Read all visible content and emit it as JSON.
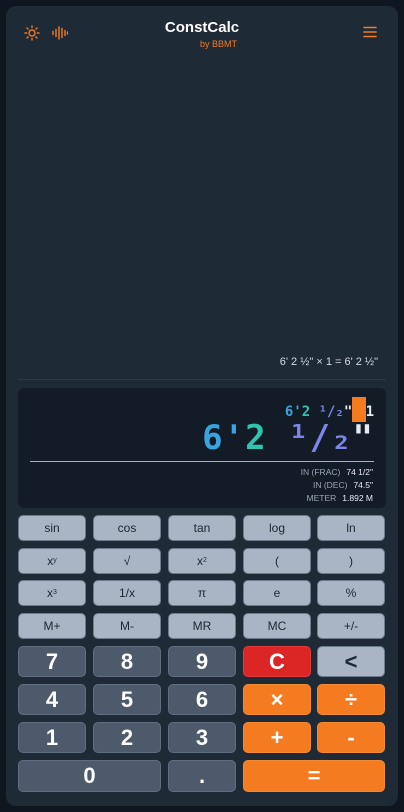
{
  "header": {
    "title": "ConstCalc",
    "subtitle": "by BBMT",
    "icons": {
      "theme": "sun-icon",
      "sound": "sound-wave-icon",
      "menu": "hamburger-menu-icon"
    }
  },
  "history": {
    "entries": [
      "6' 2 ½\" × 1 = 6' 2 ½\""
    ]
  },
  "display": {
    "expression": {
      "feet": "6'",
      "inches": "2",
      "fraction": "¹/₂",
      "inch_mark": "\"",
      "operator": "×",
      "operand": "1"
    },
    "main": {
      "feet": "6'",
      "inches": "2",
      "fraction": "¹/₂",
      "inch_mark": "\""
    },
    "conversions": [
      {
        "label": "IN (FRAC)",
        "value": "74 1/2\""
      },
      {
        "label": "IN (DEC)",
        "value": "74.5\""
      },
      {
        "label": "METER",
        "value": "1.892 M"
      }
    ]
  },
  "keys": {
    "sin": "sin",
    "cos": "cos",
    "tan": "tan",
    "log": "log",
    "ln": "ln",
    "x": "x",
    "y": "y",
    "sqrt": "√",
    "two": "2",
    "lparen": "(",
    "rparen": ")",
    "three": "3",
    "recip": "1/x",
    "pi": "π",
    "e": "e",
    "pct": "%",
    "mplus": "M+",
    "mminus": "M-",
    "mr": "MR",
    "mc": "MC",
    "neg": "+/-",
    "d7": "7",
    "d8": "8",
    "d9": "9",
    "clear": "C",
    "back": "<",
    "d4": "4",
    "d5": "5",
    "d6": "6",
    "mul": "×",
    "div": "÷",
    "d1": "1",
    "d2": "2",
    "d3": "3",
    "add": "+",
    "sub": "-",
    "d0": "0",
    "dot": ".",
    "eq": "="
  },
  "colors": {
    "accent": "#f47b20",
    "clear": "#dc2626",
    "feet": "#38a5e0",
    "inches": "#2ec4b0",
    "fraction": "#7b86e8"
  }
}
